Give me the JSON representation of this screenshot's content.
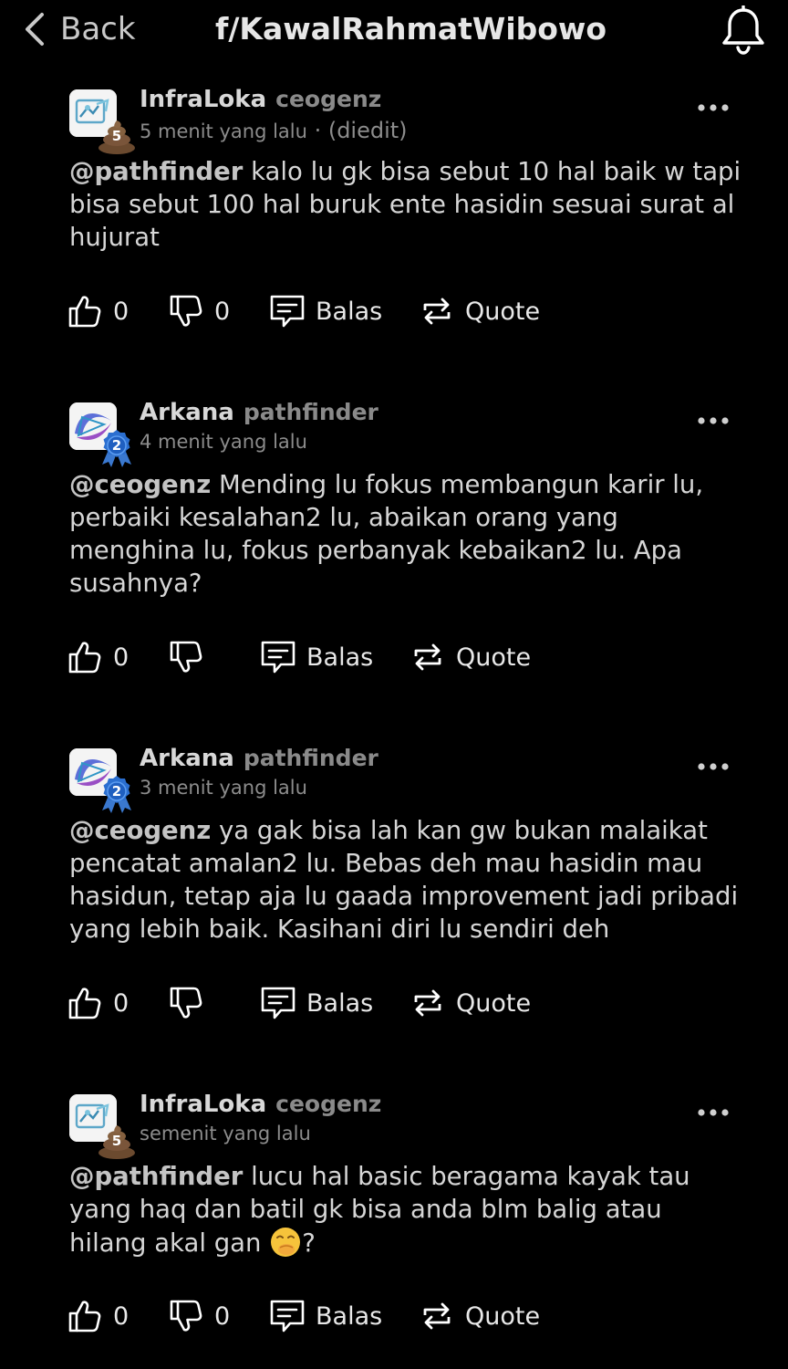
{
  "header": {
    "back_label": "Back",
    "title": "f/KawalRahmatWibowo",
    "bell_icon": "bell-icon"
  },
  "comments": [
    {
      "display_name": "InfraLoka",
      "username": "ceogenz",
      "time": "5 menit yang lalu",
      "edited": " · (diedit)",
      "rank": "5",
      "mention": "@pathfinder",
      "text": " kalo lu gk bisa sebut 10 hal baik w tapi bisa sebut 100 hal buruk ente hasidin sesuai surat al hujurat",
      "likes": "0",
      "dislikes": "0",
      "reply_label": "Balas",
      "quote_label": "Quote"
    },
    {
      "display_name": "Arkana",
      "username": "pathfinder",
      "time": "4 menit yang lalu",
      "rank": "2",
      "mention": "@ceogenz",
      "text": " Mending lu fokus membangun karir lu, perbaiki kesalahan2 lu, abaikan orang yang menghina lu, fokus perbanyak kebaikan2 lu. Apa susahnya?",
      "likes": "0",
      "reply_label": "Balas",
      "quote_label": "Quote"
    },
    {
      "display_name": "Arkana",
      "username": "pathfinder",
      "time": "3 menit yang lalu",
      "rank": "2",
      "mention": "@ceogenz",
      "text": " ya gak bisa lah kan gw bukan malaikat pencatat amalan2 lu. Bebas deh mau hasidin mau hasidun, tetap aja lu gaada improvement jadi pribadi yang lebih baik. Kasihani diri lu sendiri deh",
      "likes": "0",
      "reply_label": "Balas",
      "quote_label": "Quote"
    },
    {
      "display_name": "InfraLoka",
      "username": "ceogenz",
      "time": "semenit yang lalu",
      "rank": "5",
      "mention": "@pathfinder",
      "text": " lucu hal basic beragama kayak tau yang haq dan batil gk bisa anda blm balig atau hilang akal gan ",
      "text_end": "?",
      "likes": "0",
      "dislikes": "0",
      "reply_label": "Balas",
      "quote_label": "Quote"
    }
  ]
}
